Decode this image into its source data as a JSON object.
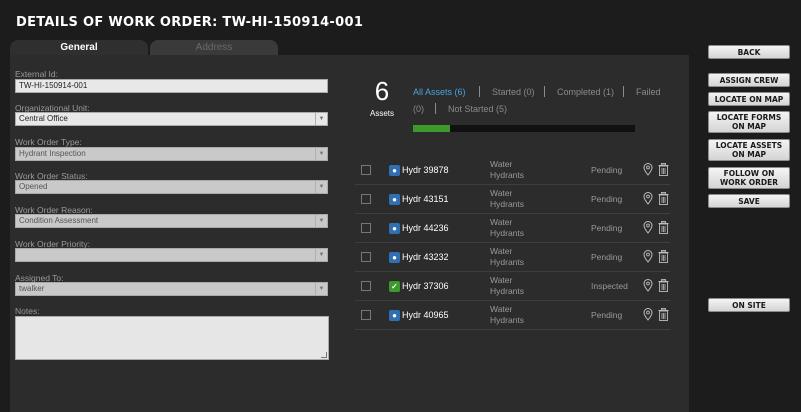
{
  "page": {
    "title": "DETAILS OF WORK ORDER: TW-HI-150914-001"
  },
  "tabs": [
    {
      "label": "General",
      "active": true
    },
    {
      "label": "Address",
      "active": false
    }
  ],
  "form": {
    "external_id": {
      "label": "External Id:",
      "value": "TW-HI-150914-001"
    },
    "org_unit": {
      "label": "Organizational Unit:",
      "value": "Central Office"
    },
    "wo_type": {
      "label": "Work Order Type:",
      "value": "Hydrant Inspection"
    },
    "wo_status": {
      "label": "Work Order Status:",
      "value": "Opened"
    },
    "wo_reason": {
      "label": "Work Order Reason:",
      "value": "Condition Assessment"
    },
    "wo_priority": {
      "label": "Work Order Priority:",
      "value": ""
    },
    "assigned_to": {
      "label": "Assigned To:",
      "value": "twalker"
    },
    "notes": {
      "label": "Notes:",
      "value": ""
    }
  },
  "assets": {
    "count": "6",
    "count_label": "Assets",
    "progress_fraction": 0.167,
    "filters": {
      "all": "All Assets (6)",
      "started": "Started (0)",
      "completed": "Completed (1)",
      "failed": "Failed",
      "failed_count": "(0)",
      "not_started": "Not Started (5)"
    },
    "rows": [
      {
        "id": "Hydr 39878",
        "type_line1": "Water",
        "type_line2": "Hydrants",
        "status": "Pending",
        "badge": "blue"
      },
      {
        "id": "Hydr 43151",
        "type_line1": "Water",
        "type_line2": "Hydrants",
        "status": "Pending",
        "badge": "blue"
      },
      {
        "id": "Hydr 44236",
        "type_line1": "Water",
        "type_line2": "Hydrants",
        "status": "Pending",
        "badge": "blue"
      },
      {
        "id": "Hydr 43232",
        "type_line1": "Water",
        "type_line2": "Hydrants",
        "status": "Pending",
        "badge": "blue"
      },
      {
        "id": "Hydr 37306",
        "type_line1": "Water",
        "type_line2": "Hydrants",
        "status": "Inspected",
        "badge": "green"
      },
      {
        "id": "Hydr 40965",
        "type_line1": "Water",
        "type_line2": "Hydrants",
        "status": "Pending",
        "badge": "blue"
      }
    ]
  },
  "buttons": {
    "back": "BACK",
    "assign_crew": "ASSIGN CREW",
    "locate_on_map": "LOCATE ON MAP",
    "locate_forms_on_map": "LOCATE FORMS ON MAP",
    "locate_assets_on_map": "LOCATE ASSETS ON MAP",
    "follow_on_work_order": "FOLLOW ON WORK ORDER",
    "save": "SAVE",
    "on_site": "ON SITE"
  },
  "colors": {
    "accent_blue": "#4aa3df",
    "progress_green": "#3c9a2b",
    "badge_blue": "#2f6fb2"
  }
}
